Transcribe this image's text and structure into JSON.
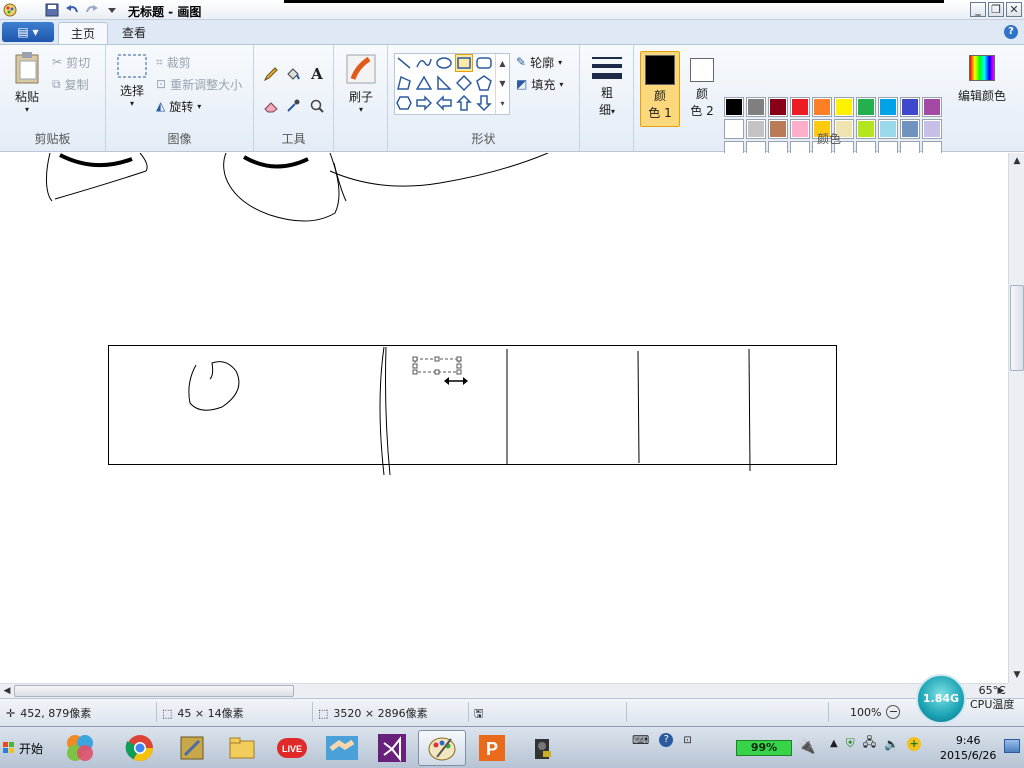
{
  "window": {
    "title": "无标题 - 画图",
    "controls": {
      "minimize": "_",
      "restore": "❐",
      "close": "✕"
    }
  },
  "tabs": {
    "app_menu": "▤ ▾",
    "home": "主页",
    "view": "查看"
  },
  "clipboard": {
    "paste": "粘贴",
    "cut": "剪切",
    "copy": "复制",
    "group": "剪贴板"
  },
  "image": {
    "select": "选择",
    "crop": "裁剪",
    "resize": "重新调整大小",
    "rotate": "旋转",
    "group": "图像"
  },
  "tools": {
    "group": "工具",
    "text_glyph": "A"
  },
  "brushes": {
    "label": "刷子"
  },
  "shapes": {
    "outline": "轮廓",
    "fill": "填充",
    "group": "形状"
  },
  "size": {
    "label_line1": "粗",
    "label_line2": "细"
  },
  "colors": {
    "color1_line1": "颜",
    "color1_line2": "色 1",
    "color2_line1": "颜",
    "color2_line2": "色 2",
    "edit": "编辑颜色",
    "group": "颜色",
    "color1": "#000000",
    "color2": "#ffffff",
    "palette_row1": [
      "#000000",
      "#7f7f7f",
      "#880015",
      "#ed1c24",
      "#ff7f27",
      "#fff200",
      "#22b14c",
      "#00a2e8",
      "#3f48cc",
      "#a349a4"
    ],
    "palette_row2": [
      "#ffffff",
      "#c3c3c3",
      "#b97a57",
      "#ffaec9",
      "#ffc90e",
      "#efe4b0",
      "#b5e61d",
      "#99d9ea",
      "#7092be",
      "#c8bfe7"
    ]
  },
  "status": {
    "cursor": "452, 879像素",
    "selection": "45 × 14像素",
    "canvas_size": "3520 × 2896像素",
    "zoom": "100%"
  },
  "temperature": {
    "gauge": "1.84G",
    "value": "65°C",
    "label": "CPU温度"
  },
  "taskbar": {
    "start": "开始",
    "battery": "99%",
    "time": "9:46",
    "date": "2015/6/26"
  }
}
